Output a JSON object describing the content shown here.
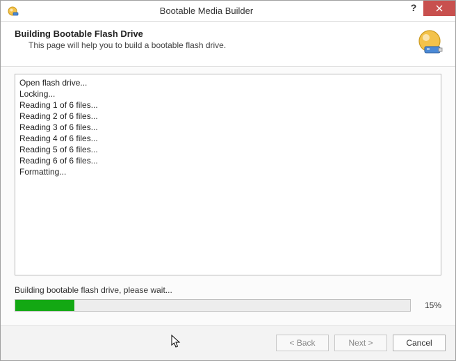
{
  "titlebar": {
    "title": "Bootable Media Builder",
    "help_label": "?",
    "close_label": "×"
  },
  "header": {
    "title": "Building Bootable Flash Drive",
    "subtitle": "This page will help you to build a bootable flash drive."
  },
  "log": {
    "lines": [
      "Open flash drive...",
      "Locking...",
      "Reading 1 of 6 files...",
      "Reading 2 of 6 files...",
      "Reading 3 of 6 files...",
      "Reading 4 of 6 files...",
      "Reading 5 of 6 files...",
      "Reading 6 of 6 files...",
      "Formatting..."
    ]
  },
  "status": {
    "text": "Building bootable flash drive, please wait...",
    "percent_label": "15%",
    "percent_value": 15
  },
  "footer": {
    "back_label": "< Back",
    "next_label": "Next >",
    "cancel_label": "Cancel"
  }
}
